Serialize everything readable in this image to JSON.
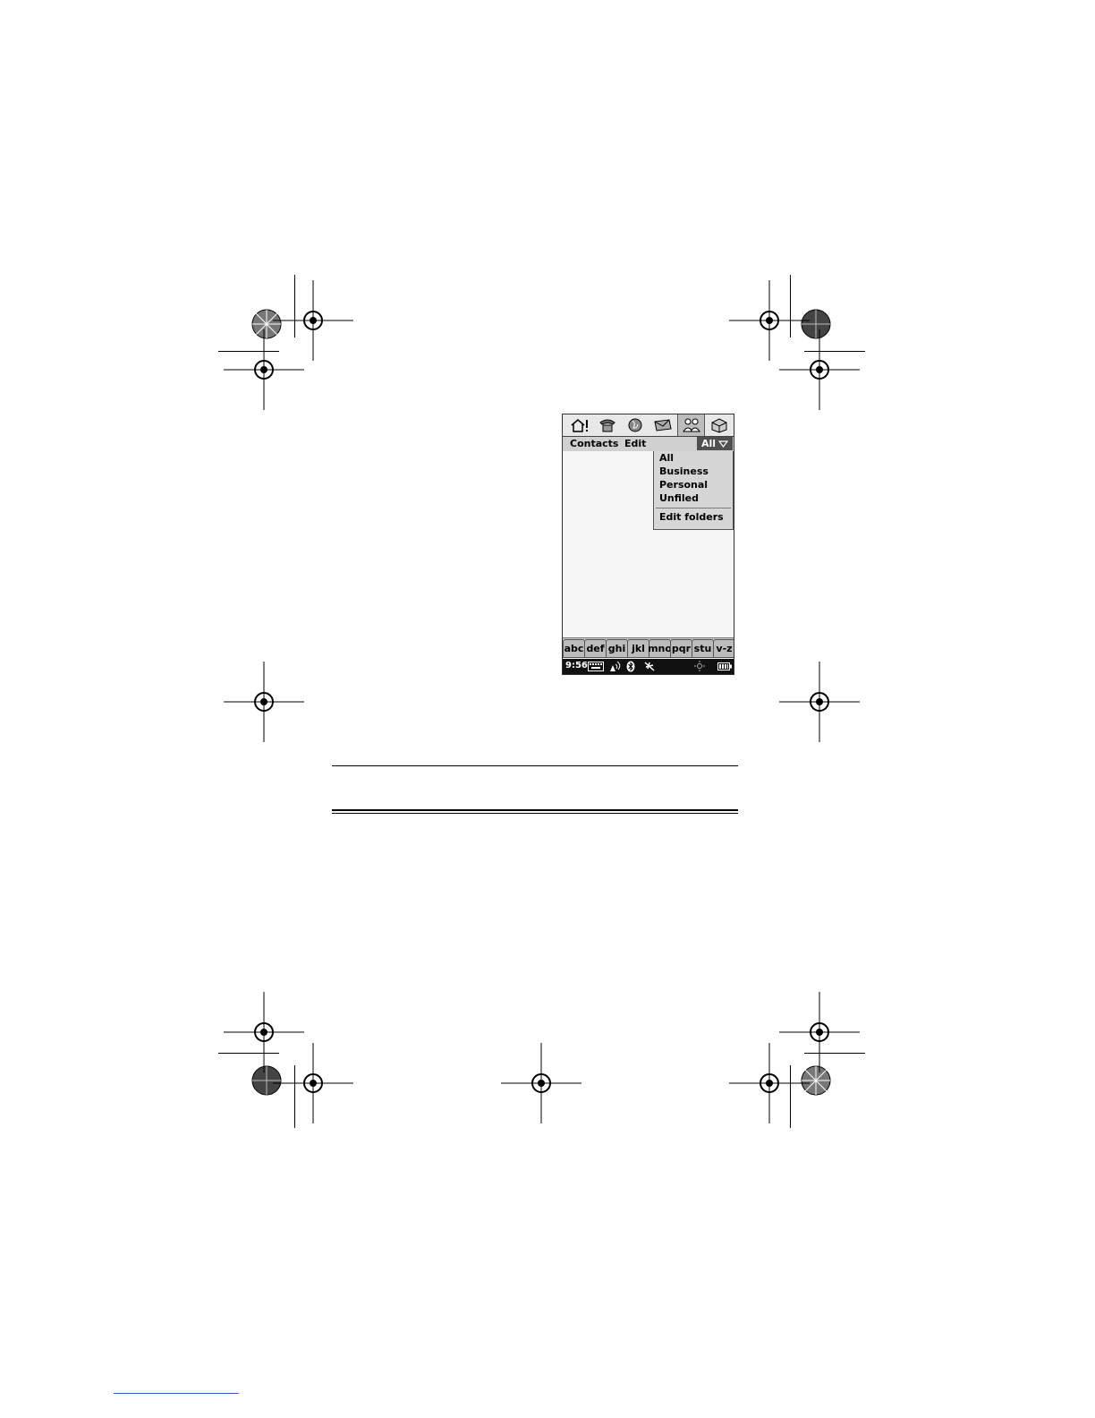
{
  "tabs": [
    {
      "name": "home-tab",
      "icon": "home-alert-icon"
    },
    {
      "name": "phone-tab",
      "icon": "phone-icon"
    },
    {
      "name": "web-tab",
      "icon": "globe-icon"
    },
    {
      "name": "messaging-tab",
      "icon": "envelope-icon"
    },
    {
      "name": "contacts-tab",
      "icon": "people-icon",
      "active": true
    },
    {
      "name": "apps-tab",
      "icon": "cube-icon"
    }
  ],
  "menubar": {
    "contacts_label": "Contacts",
    "edit_label": "Edit",
    "folder_selected": "All"
  },
  "dropdown": {
    "items": [
      "All",
      "Business",
      "Personal",
      "Unfiled"
    ],
    "edit_folders_label": "Edit folders"
  },
  "alphabet": [
    "abc",
    "def",
    "ghi",
    "jkl",
    "mno",
    "pqr",
    "stu",
    "v-z"
  ],
  "status": {
    "time": "9:56",
    "icons": [
      "keyboard-icon",
      "signal-icon",
      "bluetooth-icon",
      "airplane-icon",
      "sun-icon",
      "battery-icon"
    ]
  },
  "colors": {
    "status_bar": "#111111",
    "folder_button": "#505050",
    "menu_bg": "#d0d0d0"
  }
}
